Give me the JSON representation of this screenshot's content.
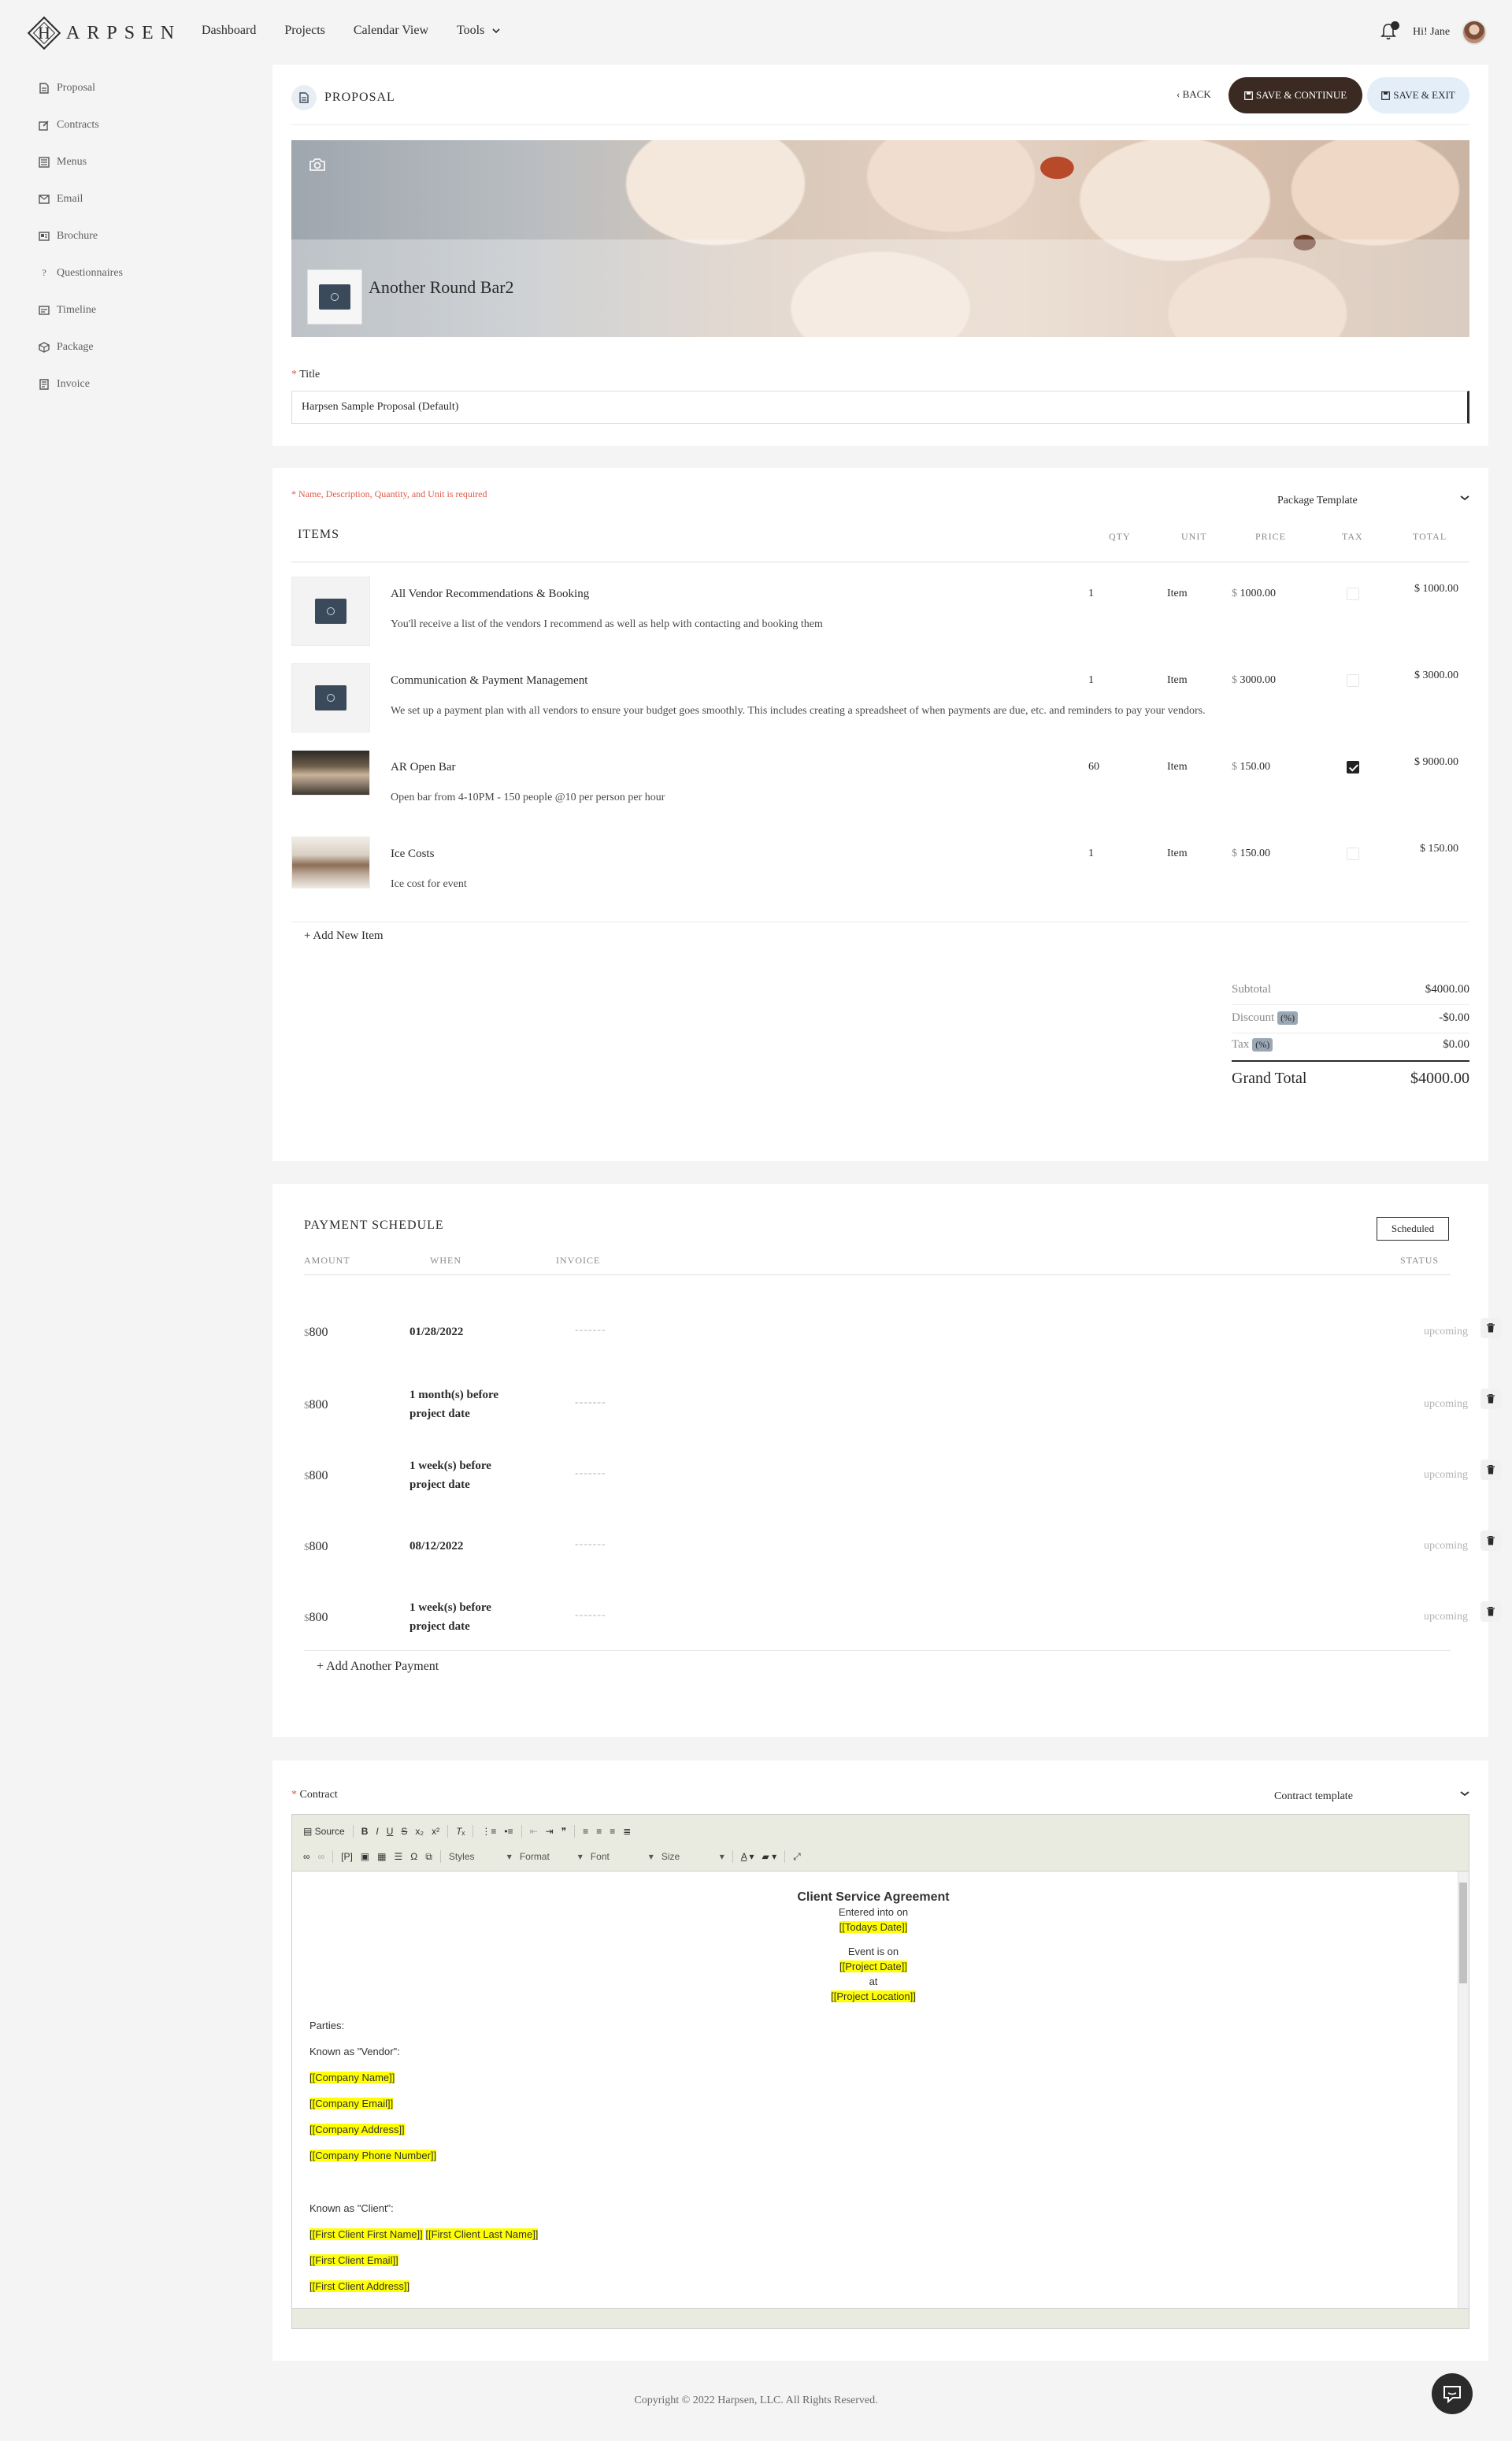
{
  "brand": {
    "logo_letter": "H",
    "logo_text": "ARPSEN"
  },
  "nav": {
    "items": [
      "Dashboard",
      "Projects",
      "Calendar View",
      "Tools"
    ],
    "greeting": "Hi! Jane"
  },
  "sidebar": {
    "items": [
      {
        "label": "Proposal",
        "icon": "document-icon"
      },
      {
        "label": "Contracts",
        "icon": "edit-icon"
      },
      {
        "label": "Menus",
        "icon": "menu-book-icon"
      },
      {
        "label": "Email",
        "icon": "envelope-icon"
      },
      {
        "label": "Brochure",
        "icon": "brochure-icon"
      },
      {
        "label": "Questionnaires",
        "icon": "question-icon"
      },
      {
        "label": "Timeline",
        "icon": "timeline-icon"
      },
      {
        "label": "Package",
        "icon": "package-icon"
      },
      {
        "label": "Invoice",
        "icon": "invoice-icon"
      }
    ]
  },
  "proposal": {
    "header": "PROPOSAL",
    "back": "BACK",
    "save_continue": "SAVE & CONTINUE",
    "save_exit": "SAVE & EXIT",
    "cover_name": "Another Round Bar2",
    "title_label": "Title",
    "title_value": "Harpsen Sample Proposal (Default)"
  },
  "items_section": {
    "required_note": "Name, Description, Quantity, and Unit is required",
    "package_template": "Package Template",
    "headers": {
      "items": "ITEMS",
      "qty": "QTY",
      "unit": "UNIT",
      "price": "PRICE",
      "tax": "TAX",
      "total": "TOTAL"
    },
    "currency": "$",
    "rows": [
      {
        "name": "All Vendor Recommendations & Booking",
        "desc": "You'll receive a list of the vendors I recommend as well as help with contacting and booking them",
        "qty": "1",
        "unit": "Item",
        "price": "1000.00",
        "taxed": false,
        "total": "$ 1000.00"
      },
      {
        "name": "Communication & Payment Management",
        "desc": "We set up a payment plan with all vendors to ensure your budget goes smoothly. This includes creating a spreadsheet of when payments are due, etc. and reminders to pay your vendors.",
        "qty": "1",
        "unit": "Item",
        "price": "3000.00",
        "taxed": false,
        "total": "$ 3000.00"
      },
      {
        "name": "AR Open Bar",
        "desc": "Open bar from 4-10PM  - 150 people @10 per person per hour",
        "qty": "60",
        "unit": "Item",
        "price": "150.00",
        "taxed": true,
        "total": "$ 9000.00"
      },
      {
        "name": "Ice Costs",
        "desc": "Ice cost for event",
        "qty": "1",
        "unit": "Item",
        "price": "150.00",
        "taxed": false,
        "total": "$ 150.00"
      }
    ],
    "add_item": "+ Add New Item",
    "totals": {
      "subtotal_label": "Subtotal",
      "subtotal": "$4000.00",
      "discount_label": "Discount",
      "discount": "-$0.00",
      "tax_label": "Tax",
      "tax": "$0.00",
      "pct": "(%)",
      "grand_label": "Grand Total",
      "grand": "$4000.00"
    }
  },
  "payment": {
    "title": "PAYMENT SCHEDULE",
    "scheduled": "Scheduled",
    "headers": {
      "amount": "AMOUNT",
      "when": "WHEN",
      "invoice": "INVOICE",
      "status": "STATUS"
    },
    "currency": "$",
    "rows": [
      {
        "amount": "800",
        "when": "01/28/2022",
        "invoice": "-------",
        "status": "upcoming"
      },
      {
        "amount": "800",
        "when": "1 month(s) before project date",
        "invoice": "-------",
        "status": "upcoming"
      },
      {
        "amount": "800",
        "when": "1 week(s) before project date",
        "invoice": "-------",
        "status": "upcoming"
      },
      {
        "amount": "800",
        "when": "08/12/2022",
        "invoice": "-------",
        "status": "upcoming"
      },
      {
        "amount": "800",
        "when": "1 week(s) before project date",
        "invoice": "-------",
        "status": "upcoming"
      }
    ],
    "add_payment": "+ Add Another Payment"
  },
  "contract": {
    "label": "Contract",
    "template": "Contract template",
    "toolbar": {
      "source": "Source",
      "styles": "Styles",
      "format": "Format",
      "font": "Font",
      "size": "Size"
    },
    "doc": {
      "title": "Client Service Agreement",
      "entered": "Entered into on",
      "todays_date": "[[Todays Date]]",
      "event_on": "Event is on",
      "project_date": "[[Project Date]]",
      "at": "at",
      "project_location": "[[Project Location]]",
      "parties": "Parties:",
      "vendor": "Known as  \"Vendor\":",
      "company_name": "[[Company Name]]",
      "company_email": "[[Company Email]]",
      "company_address": "[[Company Address]]",
      "company_phone": "[[Company Phone Number]]",
      "client": "Known as \"Client\":",
      "client_first": "[[First Client First Name]]",
      "client_last": "[[First Client Last Name]]",
      "client_email": "[[First Client Email]]",
      "client_address": "[[First Client Address]]"
    }
  },
  "footer": "Copyright © 2022 Harpsen, LLC. All Rights Reserved."
}
